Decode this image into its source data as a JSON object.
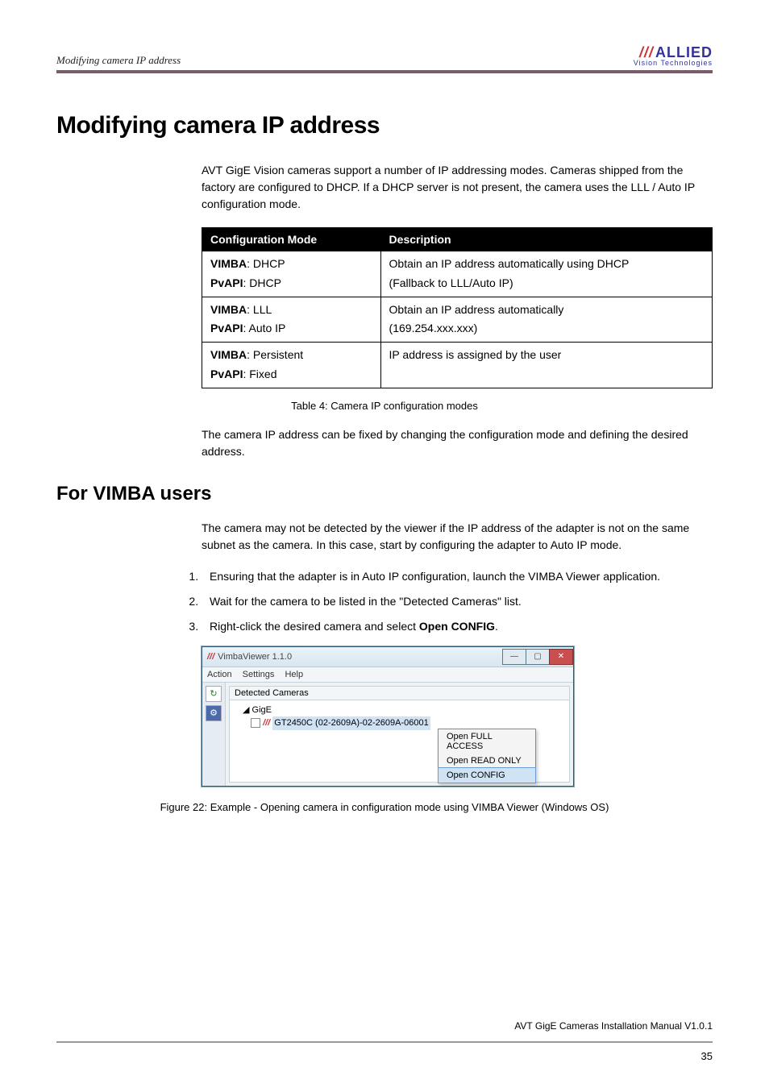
{
  "header": {
    "section_title": "Modifying camera IP address",
    "logo_brand": "ALLIED",
    "logo_sub": "Vision Technologies"
  },
  "h1": "Modifying camera IP address",
  "intro": "AVT GigE Vision cameras support a number of IP addressing modes. Cameras shipped from the factory are configured to DHCP. If a DHCP server is not present, the camera uses the LLL / Auto IP configuration mode.",
  "table": {
    "col1": "Configuration Mode",
    "col2": "Description",
    "rows": [
      {
        "mode_vimba_label": "VIMBA",
        "mode_vimba_value": ": DHCP",
        "mode_pvapi_label": "PvAPI",
        "mode_pvapi_value": ": DHCP",
        "desc_line1": "Obtain an IP address automatically using DHCP",
        "desc_line2": "(Fallback to LLL/Auto IP)"
      },
      {
        "mode_vimba_label": "VIMBA",
        "mode_vimba_value": ": LLL",
        "mode_pvapi_label": "PvAPI",
        "mode_pvapi_value": ": Auto IP",
        "desc_line1": "Obtain an IP address automatically",
        "desc_line2": "(169.254.xxx.xxx)"
      },
      {
        "mode_vimba_label": "VIMBA",
        "mode_vimba_value": ": Persistent",
        "mode_pvapi_label": "PvAPI",
        "mode_pvapi_value": ": Fixed",
        "desc_line1": "IP address is assigned by the user",
        "desc_line2": ""
      }
    ],
    "caption": "Table 4: Camera IP configuration modes"
  },
  "after_table": "The camera IP address can be fixed by changing the configuration mode and defining the desired address.",
  "h2": "For VIMBA users",
  "vimba_intro": "The camera may not be detected by the viewer if the IP address of the adapter is not on the same subnet as the camera. In this case, start by configuring the adapter to Auto IP mode.",
  "steps": {
    "s1": "Ensuring that the adapter is in Auto IP configuration, launch the VIMBA Viewer application.",
    "s2": "Wait for the camera to be listed in the \"Detected Cameras\" list.",
    "s3_pre": "Right-click the desired camera and select ",
    "s3_bold": "Open CONFIG",
    "s3_post": "."
  },
  "app": {
    "title": "VimbaViewer 1.1.0",
    "menu": {
      "m1": "Action",
      "m2": "Settings",
      "m3": "Help"
    },
    "tree_header": "Detected Cameras",
    "tree_root": "GigE",
    "tree_item": "GT2450C (02-2609A)-02-2609A-06001",
    "ctx1": "Open FULL ACCESS",
    "ctx2": "Open READ ONLY",
    "ctx3": "Open CONFIG"
  },
  "figure_caption": "Figure 22: Example - Opening camera in configuration mode using VIMBA Viewer (Windows OS)",
  "footer": {
    "doc": "AVT GigE Cameras Installation Manual V1.0.1",
    "page": "35"
  }
}
